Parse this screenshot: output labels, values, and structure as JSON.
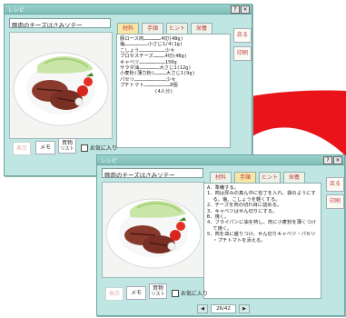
{
  "window1": {
    "title": "レシピ",
    "recipe_name": "豚肉のチーズはさみソテー",
    "tabs": [
      "材料",
      "手順",
      "ヒント",
      "栄養"
    ],
    "ingredients": [
      "豚ロース肉………………4切(4Bg)",
      "塩……………………小さじ1/4(1g)",
      "こしょう………………………少々",
      "プロセスチーズ…………4切(4Bg)",
      "キャベツ………………………150g",
      "サラダ油…………………大さじ1(12g)",
      "小麦粉(薄力粉)…………大さじ1(9g)",
      "パセリ……………………………少々",
      "プチトマト………………………8個",
      "            (4人分)"
    ],
    "side_buttons": [
      "戻る",
      "印刷"
    ],
    "bottom_buttons": {
      "disabled": "表示",
      "memo": "メモ",
      "shopping_1": "買物",
      "shopping_2": "リスト",
      "favorite": "お気に入り"
    }
  },
  "window2": {
    "title": "レシピ",
    "recipe_name": "豚肉のチーズはさみソテー",
    "tabs": [
      "材料",
      "手順",
      "ヒント",
      "栄養"
    ],
    "steps": [
      "A．準備する。",
      "",
      "1．肉は厚みの真ん中に包丁を入れ、袋のようにす",
      "  る。塩、こしょうを軽くする。",
      "2．チーズを肉の切れ目に詰める。",
      "3．キャベツはせん切りにする。",
      "",
      "B．焼く。",
      "",
      "4．フライパンに油を熱し、肉に小麦粉を薄くつけ",
      "  て焼く。",
      "5．肉を皿に盛りつけ、せん切りキャベツ・パセリ",
      "  ・プチトマトを添える。"
    ],
    "side_buttons": [
      "戻る",
      "印刷"
    ],
    "bottom_buttons": {
      "disabled": "表示",
      "memo": "メモ",
      "shopping_1": "買物",
      "shopping_2": "リスト",
      "favorite": "お気に入り"
    },
    "pager": {
      "prev": "◀",
      "page": "26/42",
      "next": "▶"
    }
  },
  "colors": {
    "window_bg": "#bfe6e2",
    "active_tab": "#f9e7a8",
    "curve_red": "#e8141a"
  }
}
